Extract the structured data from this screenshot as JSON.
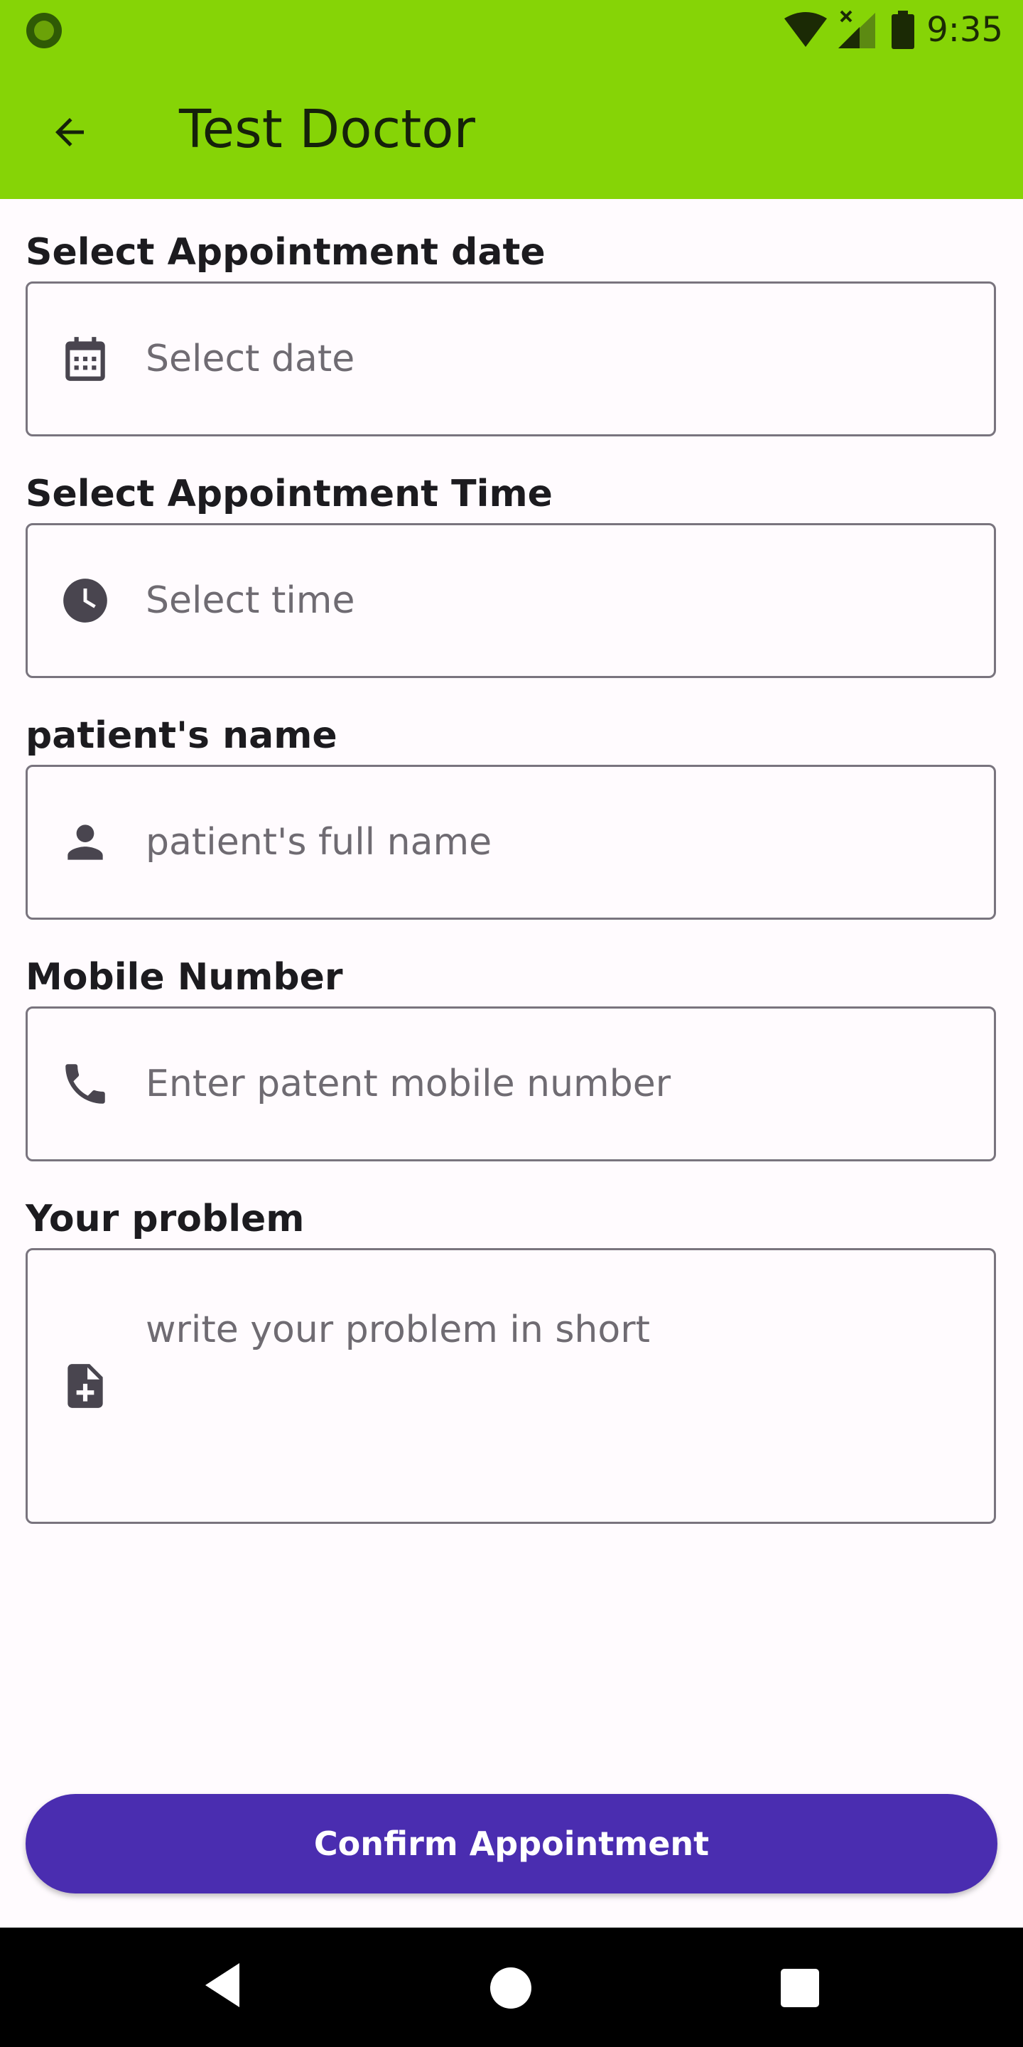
{
  "status_bar": {
    "time": "9:35",
    "icons": [
      "wifi-icon",
      "signal-icon",
      "battery-icon"
    ]
  },
  "app_bar": {
    "title": "Test Doctor",
    "back_icon": "arrow-back-icon"
  },
  "form": {
    "date": {
      "label": "Select Appointment date",
      "placeholder": "Select date",
      "icon": "calendar-icon"
    },
    "time": {
      "label": "Select Appointment Time",
      "placeholder": "Select time",
      "icon": "clock-icon"
    },
    "name": {
      "label": "patient's name",
      "placeholder": "patient's full name",
      "icon": "person-icon"
    },
    "mobile": {
      "label": "Mobile Number",
      "placeholder": "Enter patent mobile number",
      "icon": "phone-icon"
    },
    "problem": {
      "label": "Your problem",
      "placeholder": "write your problem in short",
      "icon": "note-add-icon"
    }
  },
  "confirm_button": {
    "label": "Confirm Appointment"
  },
  "colors": {
    "app_bar": "#86D406",
    "button": "#4A2DB0",
    "field_border": "#79747E",
    "icon": "#49454F"
  },
  "nav_bar": {
    "icons": [
      "nav-back-icon",
      "nav-home-icon",
      "nav-recents-icon"
    ]
  }
}
